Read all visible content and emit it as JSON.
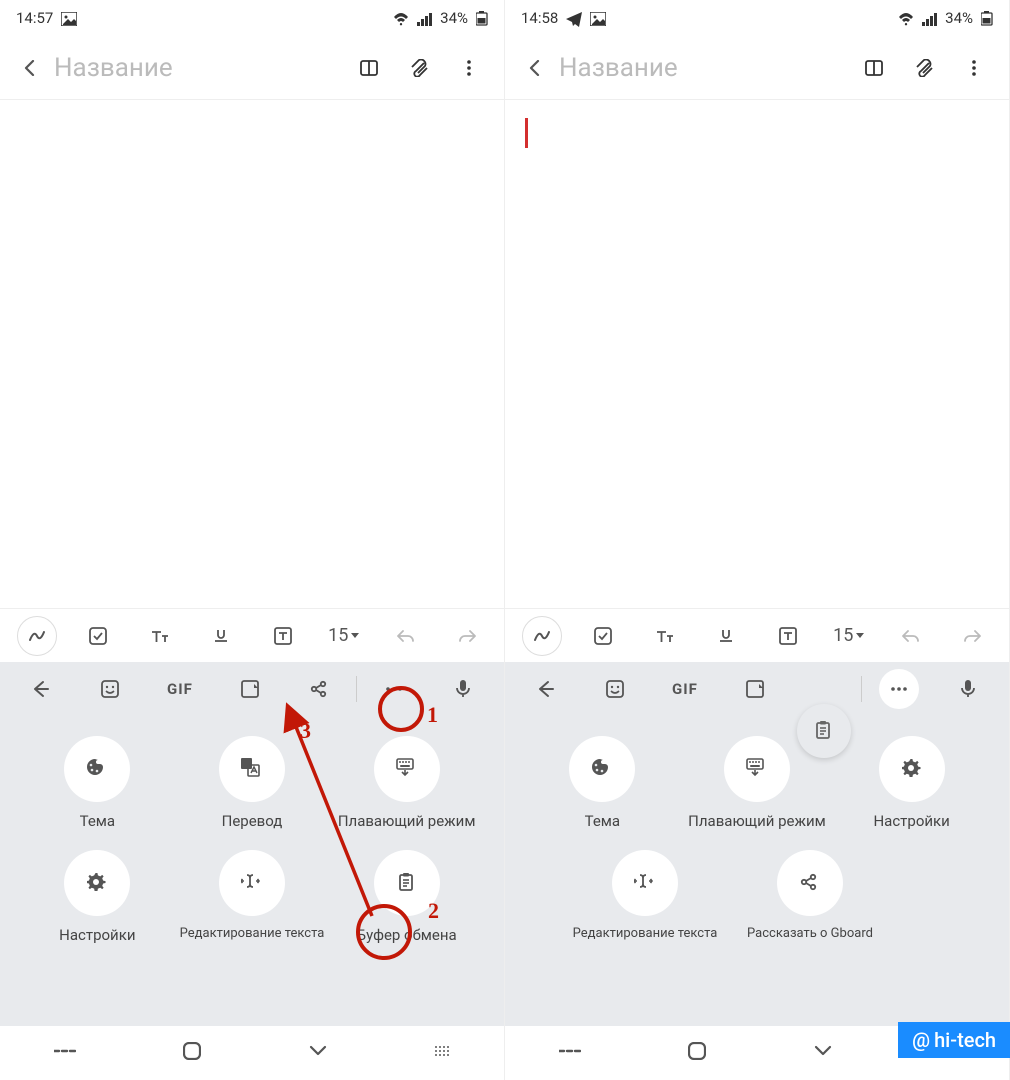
{
  "left": {
    "status": {
      "time": "14:57",
      "battery": "34%",
      "icons_left": [
        "image"
      ],
      "icons_right": [
        "wifi",
        "signal",
        "battery"
      ]
    },
    "header": {
      "title_placeholder": "Название"
    },
    "format": {
      "font_size": "15"
    },
    "sugg": {
      "gif": "GIF"
    },
    "panel": {
      "tiles_row1": [
        {
          "id": "theme",
          "label": "Тема",
          "icon": "palette"
        },
        {
          "id": "translate",
          "label": "Перевод",
          "icon": "translate"
        },
        {
          "id": "floating",
          "label": "Плавающий режим",
          "icon": "keyboard-float"
        }
      ],
      "tiles_row2": [
        {
          "id": "settings",
          "label": "Настройки",
          "icon": "gear"
        },
        {
          "id": "textedit",
          "label": "Редактирование текста",
          "icon": "text-cursor"
        },
        {
          "id": "clipboard",
          "label": "Буфер обмена",
          "icon": "clipboard"
        }
      ]
    },
    "annotations": {
      "n1": "1",
      "n2": "2",
      "n3": "3"
    }
  },
  "right": {
    "status": {
      "time": "14:58",
      "battery": "34%",
      "icons_left": [
        "telegram",
        "image"
      ],
      "icons_right": [
        "wifi",
        "signal",
        "battery"
      ]
    },
    "header": {
      "title_placeholder": "Название"
    },
    "format": {
      "font_size": "15"
    },
    "sugg": {
      "gif": "GIF"
    },
    "panel": {
      "tiles_row1": [
        {
          "id": "theme",
          "label": "Тема",
          "icon": "palette"
        },
        {
          "id": "floating",
          "label": "Плавающий режим",
          "icon": "keyboard-float"
        },
        {
          "id": "settings",
          "label": "Настройки",
          "icon": "gear"
        }
      ],
      "tiles_row2": [
        {
          "id": "textedit",
          "label": "Редактирование текста",
          "icon": "text-cursor"
        },
        {
          "id": "share",
          "label": "Рассказать о Gboard",
          "icon": "share"
        }
      ]
    }
  },
  "watermark": {
    "text": "hi-tech",
    "at": "@"
  }
}
